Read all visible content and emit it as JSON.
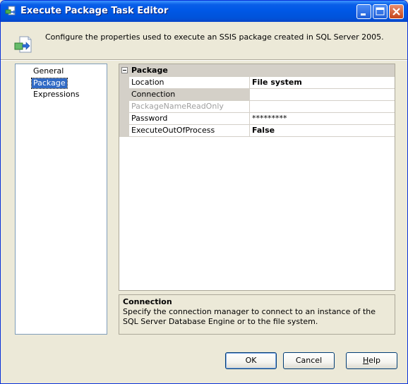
{
  "window": {
    "title": "Execute Package Task Editor"
  },
  "header": {
    "description": "Configure the properties used to execute an SSIS package created in SQL Server 2005."
  },
  "nav": {
    "items": [
      {
        "label": "General",
        "selected": false
      },
      {
        "label": "Package",
        "selected": true
      },
      {
        "label": "Expressions",
        "selected": false
      }
    ]
  },
  "properties": {
    "category": "Package",
    "rows": [
      {
        "name": "Location",
        "value": "File system",
        "bold": true,
        "disabled": false,
        "selected": false
      },
      {
        "name": "Connection",
        "value": "",
        "bold": false,
        "disabled": false,
        "selected": true
      },
      {
        "name": "PackageNameReadOnly",
        "value": "",
        "bold": false,
        "disabled": true,
        "selected": false
      },
      {
        "name": "Password",
        "value": "*********",
        "bold": false,
        "disabled": false,
        "selected": false
      },
      {
        "name": "ExecuteOutOfProcess",
        "value": "False",
        "bold": true,
        "disabled": false,
        "selected": false
      }
    ]
  },
  "description_panel": {
    "title": "Connection",
    "text": "Specify the connection manager to connect to an instance of the SQL Server Database Engine or to the file system."
  },
  "buttons": {
    "ok": "OK",
    "cancel": "Cancel",
    "help_first": "H",
    "help_rest": "elp"
  },
  "colors": {
    "titlebar": "#0058e6",
    "selection": "#316ac5",
    "dialog_bg": "#ece9d8"
  }
}
